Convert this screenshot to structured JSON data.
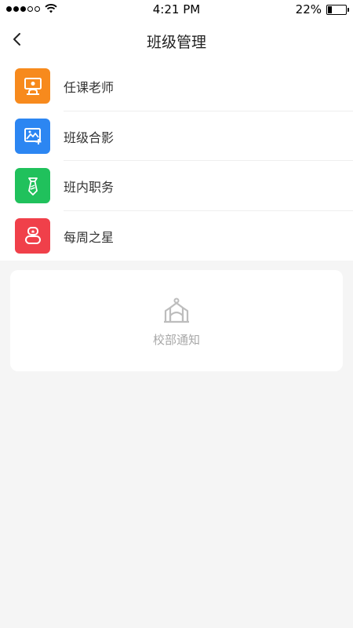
{
  "status_bar": {
    "time": "4:21 PM",
    "battery": "22%",
    "battery_level": 0.22
  },
  "nav": {
    "title": "班级管理",
    "back_icon": "chevron-left-icon"
  },
  "menu": {
    "items": [
      {
        "label": "任课老师",
        "icon": "teacher-board-icon",
        "color": "#f78a1d"
      },
      {
        "label": "班级合影",
        "icon": "photo-add-icon",
        "color": "#2c86f2"
      },
      {
        "label": "班内职务",
        "icon": "tie-icon",
        "color": "#20c15c"
      },
      {
        "label": "每周之星",
        "icon": "star-person-icon",
        "color": "#f0404a"
      }
    ]
  },
  "notice": {
    "label": "校部通知",
    "icon": "school-building-icon"
  }
}
